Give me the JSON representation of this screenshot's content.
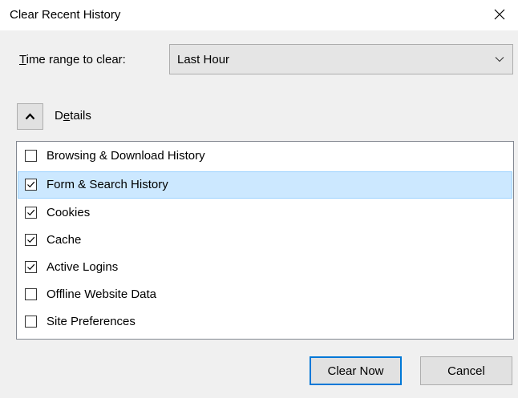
{
  "window": {
    "title": "Clear Recent History"
  },
  "time_range": {
    "label_first_char": "T",
    "label_rest": "ime range to clear:",
    "selected": "Last Hour"
  },
  "details": {
    "label_first_char": "D",
    "label_mid_char": "e",
    "label_rest": "tails",
    "expanded": true
  },
  "history_items": [
    {
      "label": "Browsing & Download History",
      "checked": false
    },
    {
      "label": "Form & Search History",
      "checked": true
    },
    {
      "label": "Cookies",
      "checked": true
    },
    {
      "label": "Cache",
      "checked": true
    },
    {
      "label": "Active Logins",
      "checked": true
    },
    {
      "label": "Offline Website Data",
      "checked": false
    },
    {
      "label": "Site Preferences",
      "checked": false
    }
  ],
  "selected_item": "Form & Search History",
  "buttons": {
    "clear_now": "Clear Now",
    "cancel": "Cancel"
  },
  "colors": {
    "selection_background": "#cce8ff",
    "default_button_border": "#0078d7",
    "dialog_background": "#f0f0f0"
  },
  "icons": {
    "close": "close-icon",
    "dropdown": "chevron-down-icon",
    "collapse": "chevron-up-icon",
    "check": "checkmark-icon"
  }
}
